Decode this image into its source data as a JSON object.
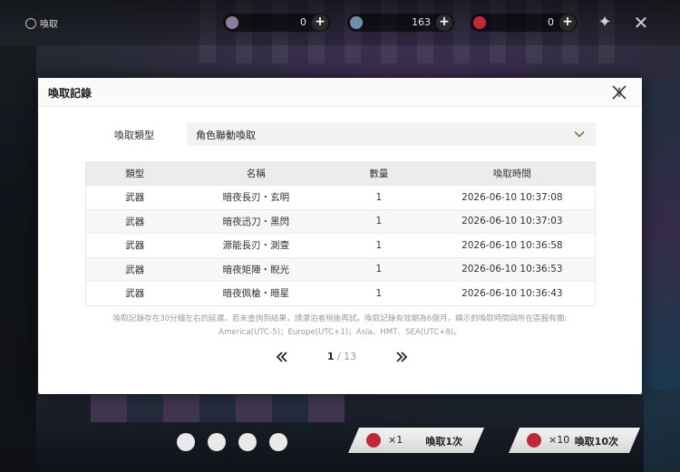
{
  "topbar": {
    "back_label": "喚取",
    "resources": [
      {
        "icon": "credit-icon",
        "value": "0"
      },
      {
        "icon": "crystal-icon",
        "value": "163"
      },
      {
        "icon": "ticket-icon",
        "value": "0"
      }
    ]
  },
  "modal": {
    "title": "喚取記錄",
    "filter": {
      "label": "喚取類型",
      "value": "角色聯動喚取"
    },
    "table": {
      "headers": [
        "類型",
        "名稱",
        "數量",
        "喚取時間"
      ],
      "rows": [
        {
          "type": "武器",
          "name": "暗夜長刃・玄明",
          "qty": "1",
          "time": "2026-06-10 10:37:08"
        },
        {
          "type": "武器",
          "name": "暗夜迅刀・黑閃",
          "qty": "1",
          "time": "2026-06-10 10:37:03"
        },
        {
          "type": "武器",
          "name": "源能長刃・測壹",
          "qty": "1",
          "time": "2026-06-10 10:36:58"
        },
        {
          "type": "武器",
          "name": "暗夜矩陣・睨光",
          "qty": "1",
          "time": "2026-06-10 10:36:53"
        },
        {
          "type": "武器",
          "name": "暗夜佩槍・暗星",
          "qty": "1",
          "time": "2026-06-10 10:36:43"
        }
      ]
    },
    "notice_line1": "喚取記錄存在30分鐘左右的延遲。若未查詢到結果，請漂泊者稍後再試。喚取記錄有效期為6個月，顯示的喚取時間與所在區服有關:",
    "notice_line2": "America(UTC-5)；Europe(UTC+1)；Asia、HMT、SEA(UTC+8)。",
    "pagination": {
      "current": "1",
      "separator": " / ",
      "total": "13"
    }
  },
  "bottom": {
    "pull_one": {
      "count": "×1",
      "label": "喚取1次"
    },
    "pull_ten": {
      "count": "×10",
      "label": "喚取10次"
    }
  },
  "colors": {
    "accent_red": "#c0283a",
    "modal_bg": "#ffffff",
    "header_bg": "#ececec",
    "chevron": "#8a7340"
  }
}
